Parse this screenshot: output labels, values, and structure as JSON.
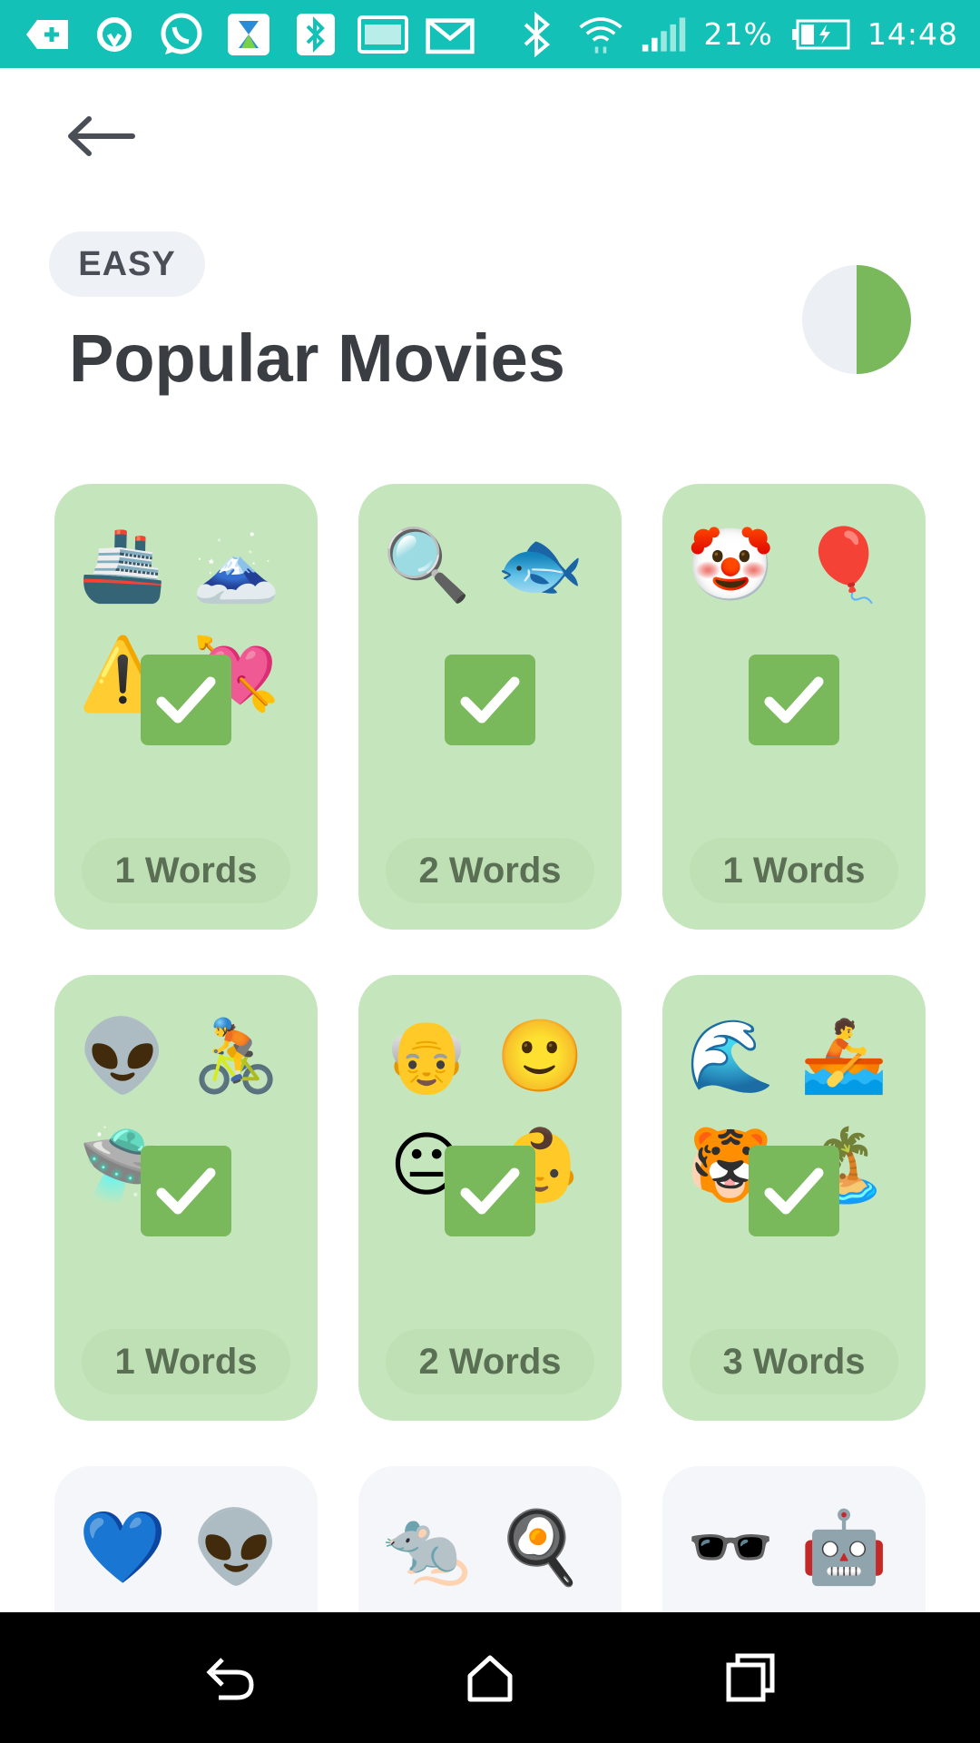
{
  "status_bar": {
    "battery": "21%",
    "time": "14:48",
    "icons_left": [
      "add-icon",
      "sync-icon",
      "whatsapp-icon",
      "hourglass-app-icon",
      "bluetooth-app-icon",
      "gallery-icon",
      "mail-icon"
    ],
    "icons_right": [
      "bluetooth-icon",
      "wifi-icon",
      "signal-icon",
      "battery-icon"
    ]
  },
  "header": {
    "difficulty": "EASY",
    "title": "Popular Movies",
    "progress": 0.5,
    "colors": {
      "progress_fill": "#7ab85c",
      "progress_track": "#eceff3"
    }
  },
  "cards": [
    {
      "emojis": [
        "🚢",
        "🗻",
        "⚠️",
        "💘"
      ],
      "words_label": "1 Words",
      "completed": true
    },
    {
      "emojis": [
        "🔍",
        "🐟"
      ],
      "words_label": "2 Words",
      "completed": true
    },
    {
      "emojis": [
        "🤡",
        "🎈"
      ],
      "words_label": "1 Words",
      "completed": true
    },
    {
      "emojis": [
        "👽",
        "🚴",
        "🛸"
      ],
      "words_label": "1 Words",
      "completed": true
    },
    {
      "emojis": [
        "👴",
        "🙂",
        "😐",
        "👶"
      ],
      "words_label": "2 Words",
      "completed": true
    },
    {
      "emojis": [
        "🌊",
        "🚣",
        "🐯",
        "🏝️"
      ],
      "words_label": "3 Words",
      "completed": true
    },
    {
      "emojis": [
        "💙",
        "👽"
      ],
      "words_label": "",
      "completed": false
    },
    {
      "emojis": [
        "🐀",
        "🍳"
      ],
      "words_label": "",
      "completed": false
    },
    {
      "emojis": [
        "🕶️",
        "🤖"
      ],
      "words_label": "",
      "completed": false
    }
  ],
  "nav": [
    "back-nav-icon",
    "home-nav-icon",
    "recents-nav-icon"
  ],
  "colors": {
    "status_bar": "#14c1b6",
    "card_done": "#c5e6bd",
    "check": "#7ab85c",
    "card_locked": "#f4f6fa"
  }
}
